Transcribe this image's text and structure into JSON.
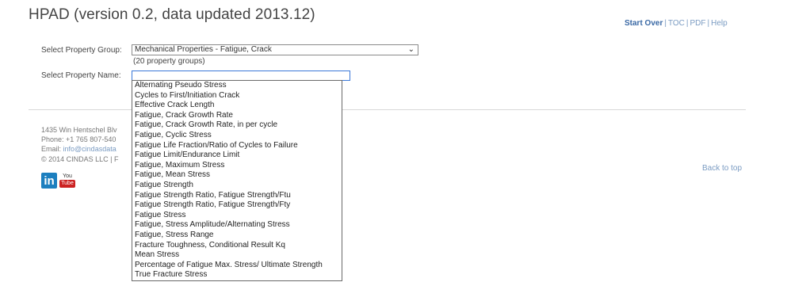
{
  "page": {
    "title": "HPAD (version 0.2, data updated 2013.12)"
  },
  "top_links": {
    "start_over": "Start Over",
    "toc": "TOC",
    "pdf": "PDF",
    "help": "Help",
    "separator": "|"
  },
  "form": {
    "group_label": "Select Property Group:",
    "group_value": "Mechanical Properties - Fatigue, Crack",
    "group_hint": "(20 property groups)",
    "name_label": "Select Property Name:",
    "name_value": "",
    "options": [
      "Alternating Pseudo Stress",
      "Cycles to First/Initiation Crack",
      "Effective Crack Length",
      "Fatigue, Crack Growth Rate",
      "Fatigue, Crack Growth Rate, in per cycle",
      "Fatigue, Cyclic Stress",
      "Fatigue Life Fraction/Ratio of Cycles to Failure",
      "Fatigue Limit/Endurance Limit",
      "Fatigue, Maximum Stress",
      "Fatigue, Mean Stress",
      "Fatigue Strength",
      "Fatigue Strength Ratio, Fatigue Strength/Ftu",
      "Fatigue Strength Ratio, Fatigue Strength/Fty",
      "Fatigue Stress",
      "Fatigue, Stress Amplitude/Alternating Stress",
      "Fatigue, Stress Range",
      "Fracture Toughness, Conditional Result Kq",
      "Mean Stress",
      "Percentage of Fatigue Max. Stress/ Ultimate Strength",
      "True Fracture Stress"
    ]
  },
  "footer": {
    "address": "1435 Win Hentschel Blv",
    "phone": "Phone: +1 765 807-540",
    "email_label": "Email:",
    "email": "info@cindasdata",
    "copyright": "© 2014 CINDAS LLC | F",
    "back_to_top": "Back to top",
    "linkedin": "in",
    "youtube_top": "You",
    "youtube_bottom": "Tube"
  },
  "colors": {
    "link": "#7a9bc2",
    "focus_border": "#3b78d8",
    "linkedin": "#1c7fbf",
    "youtube": "#cc2222"
  }
}
